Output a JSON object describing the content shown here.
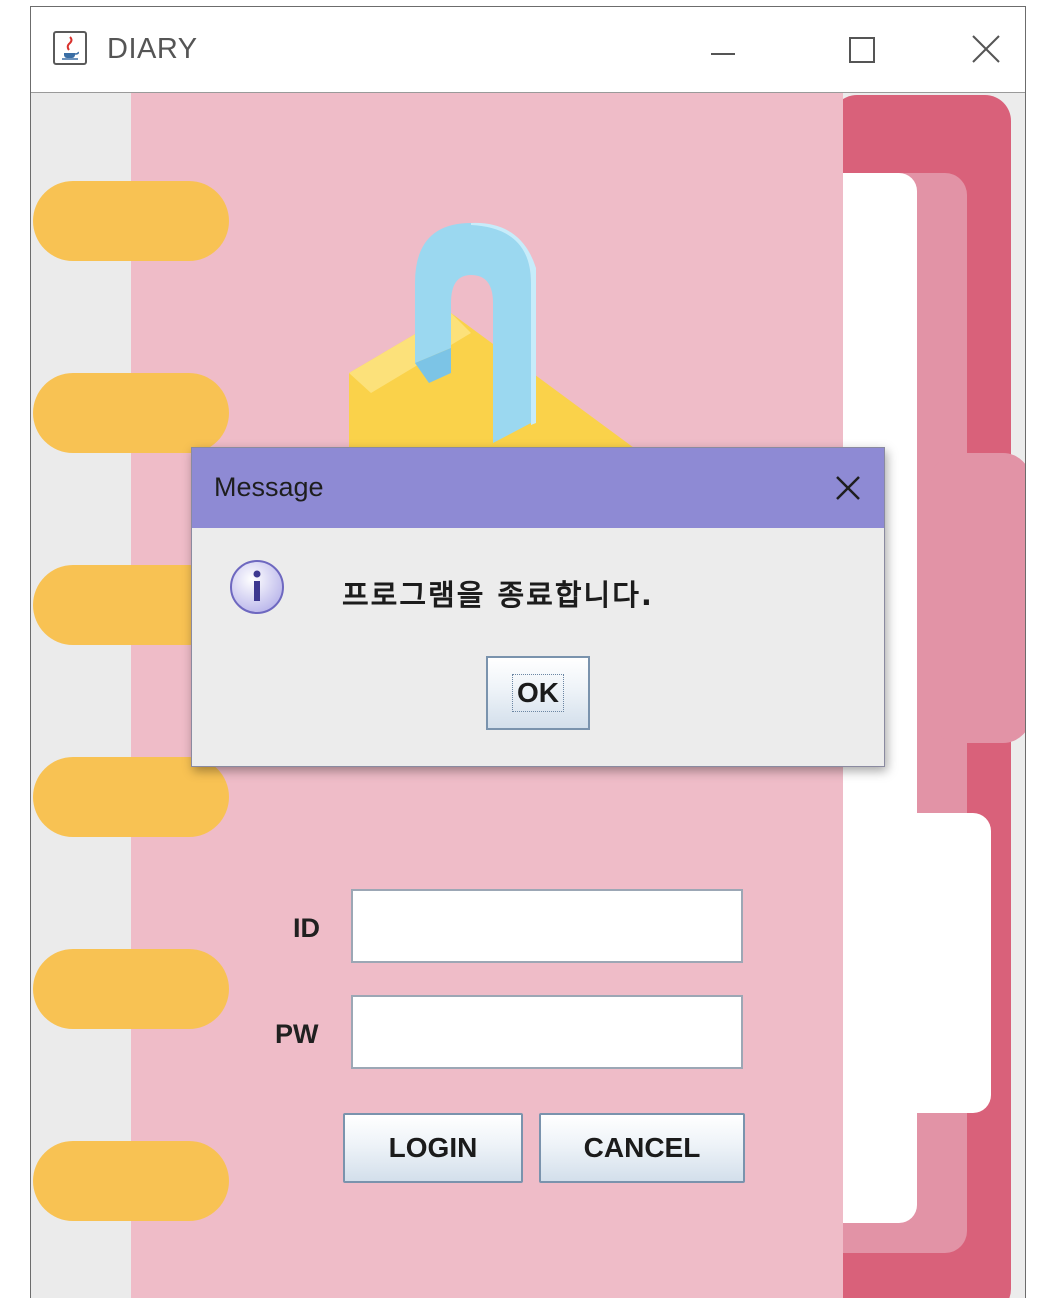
{
  "window": {
    "title": "DIARY",
    "icon": "java-cup-icon",
    "controls": [
      "minimize-icon",
      "maximize-icon",
      "close-icon"
    ]
  },
  "login": {
    "id_label": "ID",
    "pw_label": "PW",
    "id_value": "",
    "pw_value": "",
    "login_label": "LOGIN",
    "cancel_label": "CANCEL"
  },
  "dialog": {
    "title": "Message",
    "message": "프로그램을 종료합니다.",
    "ok_label": "OK",
    "icon": "info-icon"
  },
  "colors": {
    "page_pink": "#efbcc8",
    "spine_gray": "#ebebeb",
    "ring_yellow": "#f8c253",
    "tab_dark": "#d9617a",
    "tab_light": "#e293a6",
    "dialog_titlebar": "#8e8ad4",
    "lock_blue": "#9bd8f0",
    "lock_yellow": "#fad24a"
  }
}
